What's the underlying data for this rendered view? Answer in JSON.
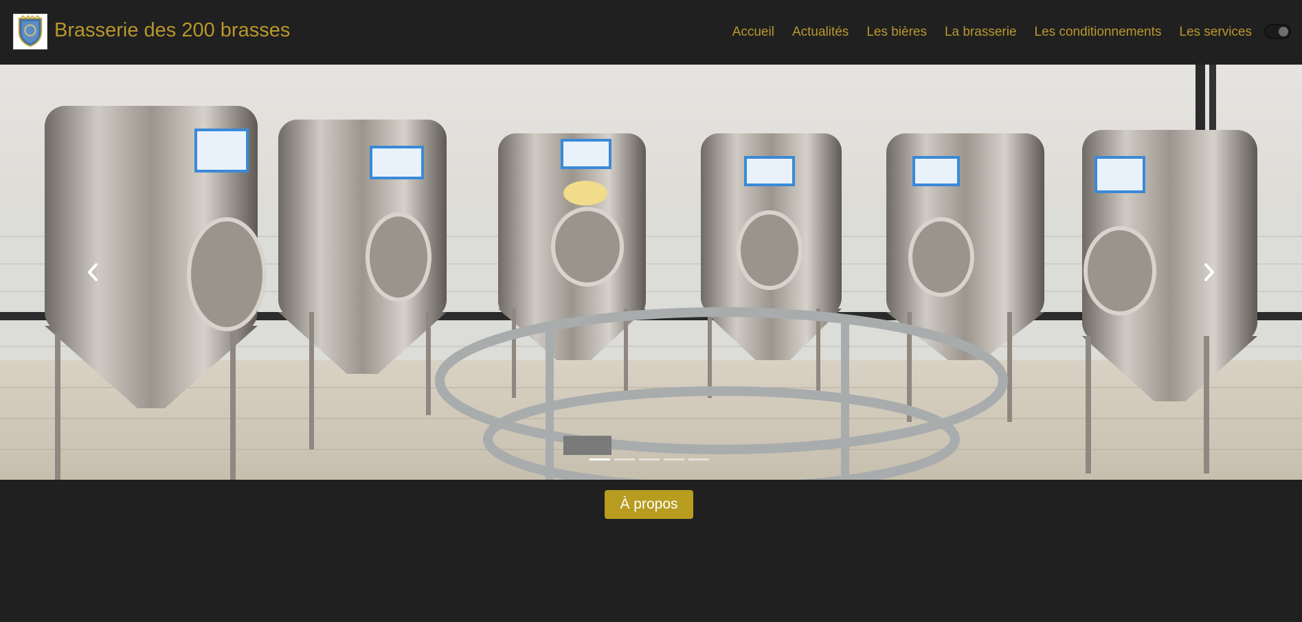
{
  "header": {
    "brand_name": "Brasserie des 200 brasses",
    "logo_icon": "coat-of-arms-icon",
    "nav_items": [
      {
        "label": "Accueil"
      },
      {
        "label": "Actualités"
      },
      {
        "label": "Les bières"
      },
      {
        "label": "La brasserie"
      },
      {
        "label": "Les conditionnements"
      },
      {
        "label": "Les services"
      }
    ],
    "theme_toggle": {
      "state": "on",
      "icon": "dark-mode-toggle"
    }
  },
  "carousel": {
    "slide_count": 5,
    "active_slide": 1,
    "prev_icon": "chevron-left-icon",
    "next_icon": "chevron-right-icon"
  },
  "main": {
    "about_button_label": "À propos"
  },
  "colors": {
    "background": "#202020",
    "accent": "#b9972c",
    "button": "#b79c20",
    "button_text": "#ffffff"
  }
}
